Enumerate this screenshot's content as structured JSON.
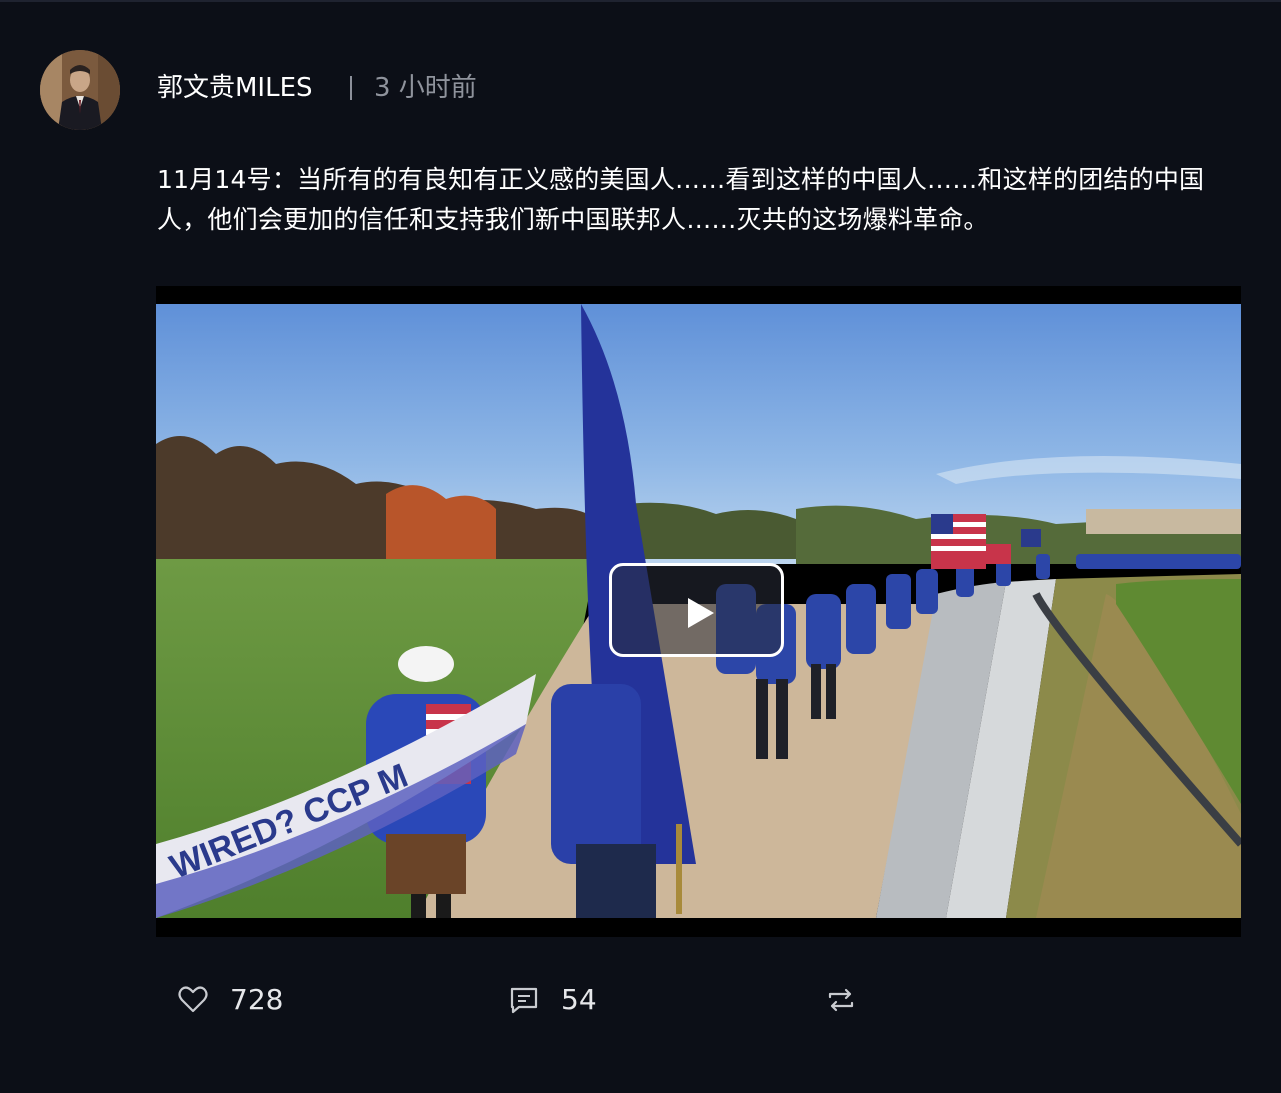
{
  "post": {
    "author": "郭文贵MILES",
    "time": "3 小时前",
    "text": "11月14号：当所有的有良知有正义感的美国人……看到这样的中国人……和这样的团结的中国人，他们会更加的信任和支持我们新中国联邦人……灭共的这场爆料革命。"
  },
  "video": {
    "banner_text": "WIRED? CCP M"
  },
  "actions": {
    "likes": "728",
    "comments": "54"
  },
  "icons": {
    "like": "heart-icon",
    "comment": "comment-icon",
    "repost": "repost-icon",
    "play": "play-icon"
  },
  "colors": {
    "background": "#0c0f17",
    "text": "#ffffff",
    "muted": "#8f939c"
  }
}
